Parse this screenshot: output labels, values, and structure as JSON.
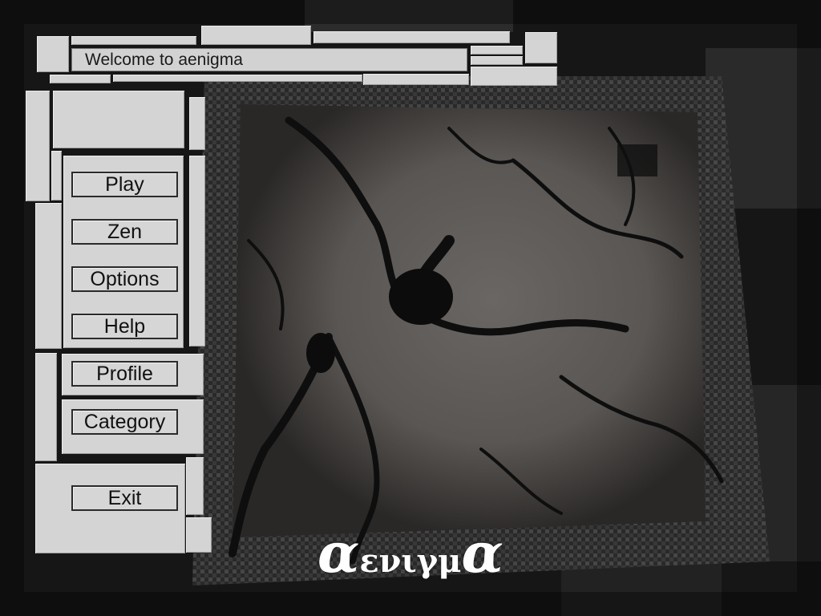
{
  "header": {
    "welcome_text": "Welcome to aenigma"
  },
  "menu": {
    "play_label": "Play",
    "zen_label": "Zen",
    "options_label": "Options",
    "help_label": "Help",
    "profile_label": "Profile",
    "category_label": "Category",
    "exit_label": "Exit"
  },
  "logo": {
    "first": "α",
    "middle": "ενιγμ",
    "last": "α"
  },
  "colors": {
    "panel": "#d4d4d4",
    "button_border": "#2a2a2a",
    "background": "#1a1a1a",
    "logo": "#ffffff"
  }
}
